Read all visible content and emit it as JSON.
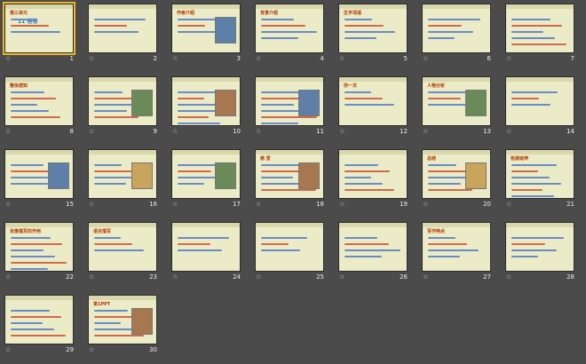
{
  "slides": [
    {
      "n": "1",
      "title": "第三单元",
      "sub": "11 爸爸"
    },
    {
      "n": "2",
      "title": ""
    },
    {
      "n": "3",
      "title": "作者介绍"
    },
    {
      "n": "4",
      "title": "背景介绍"
    },
    {
      "n": "5",
      "title": "生字词语"
    },
    {
      "n": "6",
      "title": ""
    },
    {
      "n": "7",
      "title": ""
    },
    {
      "n": "8",
      "title": "整体感知"
    },
    {
      "n": "9",
      "title": ""
    },
    {
      "n": "10",
      "title": ""
    },
    {
      "n": "11",
      "title": ""
    },
    {
      "n": "12",
      "title": "你一次"
    },
    {
      "n": "13",
      "title": "人物分析"
    },
    {
      "n": "14",
      "title": ""
    },
    {
      "n": "15",
      "title": ""
    },
    {
      "n": "16",
      "title": ""
    },
    {
      "n": "17",
      "title": ""
    },
    {
      "n": "18",
      "title": "慈 爱"
    },
    {
      "n": "19",
      "title": ""
    },
    {
      "n": "20",
      "title": "总结"
    },
    {
      "n": "21",
      "title": "拓展延伸"
    },
    {
      "n": "22",
      "title": "肖像描写的作用"
    },
    {
      "n": "23",
      "title": "语言描写"
    },
    {
      "n": "24",
      "title": ""
    },
    {
      "n": "25",
      "title": ""
    },
    {
      "n": "26",
      "title": ""
    },
    {
      "n": "27",
      "title": "写作特点"
    },
    {
      "n": "28",
      "title": ""
    },
    {
      "n": "29",
      "title": ""
    },
    {
      "n": "30",
      "title": "第1PPT"
    }
  ],
  "star": "☆"
}
